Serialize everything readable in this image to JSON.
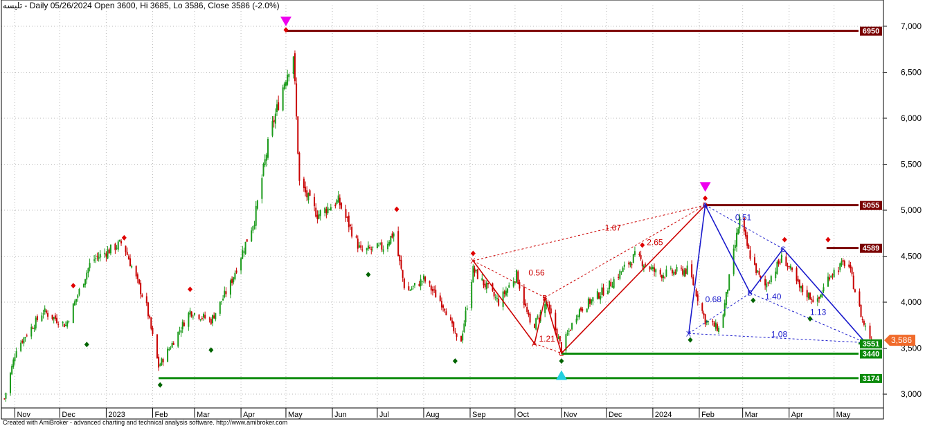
{
  "header": {
    "title": "تلیسه - Daily 05/26/2024 Open 3600, Hi 3685, Lo 3586, Close 3586 (-2.0%)"
  },
  "footer": {
    "text": "Created with AmiBroker - advanced charting and technical analysis software. http://www.amibroker.com"
  },
  "colors": {
    "resistance": "#7a0000",
    "support": "#0b8a0b",
    "pattern_red": "#cc0000",
    "pattern_blue": "#1a1acc",
    "last_price": "#f06a2a",
    "sell_marker": "#ee00ee",
    "buy_marker": "#22d0e0"
  },
  "chart_data": {
    "type": "candlestick",
    "ylim": [
      2850,
      7150
    ],
    "y_ticks": [
      "3,000",
      "3,500",
      "4,000",
      "4,500",
      "5,000",
      "5,500",
      "6,000",
      "6,500",
      "7,000"
    ],
    "x_labels": [
      "Nov",
      "Dec",
      "2023",
      "Feb",
      "Mar",
      "Apr",
      "May",
      "Jun",
      "Jul",
      "Aug",
      "Sep",
      "Oct",
      "Nov",
      "Dec",
      "2024",
      "Feb",
      "Mar",
      "Apr",
      "May"
    ],
    "x_dates": [
      "2022-11-01",
      "2022-12-01",
      "2023-01-01",
      "2023-02-01",
      "2023-03-01",
      "2023-04-01",
      "2023-05-01",
      "2023-06-01",
      "2023-07-01",
      "2023-08-01",
      "2023-09-01",
      "2023-10-01",
      "2023-11-01",
      "2023-12-01",
      "2024-01-01",
      "2024-02-01",
      "2024-03-01",
      "2024-04-01",
      "2024-05-01"
    ],
    "price_path": [
      [
        "2022-10-25",
        2950
      ],
      [
        "2022-11-02",
        3500
      ],
      [
        "2022-11-20",
        3900
      ],
      [
        "2022-12-05",
        3750
      ],
      [
        "2022-12-22",
        4450
      ],
      [
        "2023-01-12",
        4650
      ],
      [
        "2023-01-28",
        3950
      ],
      [
        "2023-02-05",
        3300
      ],
      [
        "2023-02-14",
        3550
      ],
      [
        "2023-02-26",
        3900
      ],
      [
        "2023-03-12",
        3800
      ],
      [
        "2023-03-25",
        4200
      ],
      [
        "2023-04-10",
        4900
      ],
      [
        "2023-04-20",
        5800
      ],
      [
        "2023-04-30",
        6400
      ],
      [
        "2023-05-06",
        6700
      ],
      [
        "2023-05-10",
        5300
      ],
      [
        "2023-05-22",
        4950
      ],
      [
        "2023-06-05",
        5100
      ],
      [
        "2023-06-20",
        4550
      ],
      [
        "2023-07-05",
        4600
      ],
      [
        "2023-07-12",
        4750
      ],
      [
        "2023-07-20",
        4100
      ],
      [
        "2023-08-01",
        4250
      ],
      [
        "2023-08-15",
        3950
      ],
      [
        "2023-08-25",
        3500
      ],
      [
        "2023-09-03",
        4350
      ],
      [
        "2023-09-20",
        4000
      ],
      [
        "2023-10-02",
        4300
      ],
      [
        "2023-10-12",
        3700
      ],
      [
        "2023-10-22",
        4000
      ],
      [
        "2023-11-01",
        3500
      ],
      [
        "2023-11-12",
        3900
      ],
      [
        "2023-12-01",
        4150
      ],
      [
        "2023-12-20",
        4500
      ],
      [
        "2024-01-05",
        4300
      ],
      [
        "2024-01-25",
        4350
      ],
      [
        "2024-02-05",
        3800
      ],
      [
        "2024-02-15",
        3700
      ],
      [
        "2024-02-28",
        4900
      ],
      [
        "2024-03-05",
        4550
      ],
      [
        "2024-03-15",
        4150
      ],
      [
        "2024-03-28",
        4500
      ],
      [
        "2024-04-08",
        4150
      ],
      [
        "2024-04-20",
        4000
      ],
      [
        "2024-04-28",
        4300
      ],
      [
        "2024-05-10",
        4450
      ],
      [
        "2024-05-20",
        3800
      ],
      [
        "2024-05-26",
        3586
      ]
    ],
    "levels": [
      {
        "value": 6950,
        "label": "6950",
        "kind": "resistance",
        "from": "2023-05-01"
      },
      {
        "value": 5055,
        "label": "5055",
        "kind": "resistance",
        "from": "2024-02-05"
      },
      {
        "value": 4589,
        "label": "4589",
        "kind": "resistance",
        "from": "2024-04-26"
      },
      {
        "value": 3551,
        "label": "3551",
        "kind": "support",
        "from": "2024-05-22"
      },
      {
        "value": 3440,
        "label": "3440",
        "kind": "support",
        "from": "2023-11-01"
      },
      {
        "value": 3174,
        "label": "3174",
        "kind": "support",
        "from": "2023-02-05"
      }
    ],
    "last_price": {
      "value": 3586,
      "label": "3,586"
    },
    "patterns": [
      {
        "name": "red",
        "points": [
          {
            "label": "X",
            "date": "2023-09-03",
            "value": 4450
          },
          {
            "label": "A",
            "date": "2023-10-14",
            "value": 3550
          },
          {
            "label": "B",
            "date": "2023-10-21",
            "value": 4050
          },
          {
            "label": "C",
            "date": "2023-11-01",
            "value": 3445
          },
          {
            "label": "D",
            "date": "2024-02-05",
            "value": 5055
          }
        ],
        "ratios": [
          {
            "text": "0.56",
            "date": "2023-10-10",
            "value": 4290
          },
          {
            "text": "1.21",
            "date": "2023-10-17",
            "value": 3570
          },
          {
            "text": "1.67",
            "date": "2023-11-30",
            "value": 4780
          },
          {
            "text": "2.65",
            "date": "2023-12-28",
            "value": 4620
          }
        ]
      },
      {
        "name": "blue",
        "points": [
          {
            "label": "X",
            "date": "2024-01-25",
            "value": 3660
          },
          {
            "label": "A",
            "date": "2024-02-05",
            "value": 5055
          },
          {
            "label": "B",
            "date": "2024-03-06",
            "value": 4100
          },
          {
            "label": "C",
            "date": "2024-03-28",
            "value": 4580
          },
          {
            "label": "D",
            "date": "2024-05-22",
            "value": 3560
          }
        ],
        "ratios": [
          {
            "text": "0.51",
            "date": "2024-02-25",
            "value": 4890
          },
          {
            "text": "0.68",
            "date": "2024-02-05",
            "value": 4000
          },
          {
            "text": "1.40",
            "date": "2024-03-16",
            "value": 4030
          },
          {
            "text": "1.13",
            "date": "2024-04-15",
            "value": 3860
          },
          {
            "text": "1.08",
            "date": "2024-03-20",
            "value": 3620
          }
        ]
      }
    ],
    "highs": [
      [
        "2022-12-10",
        4180
      ],
      [
        "2023-01-13",
        4700
      ],
      [
        "2023-02-26",
        4140
      ],
      [
        "2023-05-01",
        6960
      ],
      [
        "2023-07-14",
        5010
      ],
      [
        "2023-09-03",
        4530
      ],
      [
        "2023-12-25",
        4620
      ],
      [
        "2024-02-05",
        5130
      ],
      [
        "2024-03-29",
        4680
      ],
      [
        "2024-04-27",
        4680
      ]
    ],
    "lows": [
      [
        "2022-12-19",
        3540
      ],
      [
        "2023-02-06",
        3100
      ],
      [
        "2023-03-12",
        3480
      ],
      [
        "2023-06-25",
        4300
      ],
      [
        "2023-08-22",
        3360
      ],
      [
        "2023-11-01",
        3360
      ],
      [
        "2024-01-26",
        3590
      ],
      [
        "2024-03-08",
        4020
      ],
      [
        "2024-04-15",
        3820
      ]
    ],
    "sell_signals": [
      {
        "date": "2023-05-01",
        "value": 7000
      },
      {
        "date": "2024-02-05",
        "value": 5200
      }
    ],
    "buy_signals": [
      {
        "date": "2023-11-01",
        "value": 3260
      }
    ]
  }
}
